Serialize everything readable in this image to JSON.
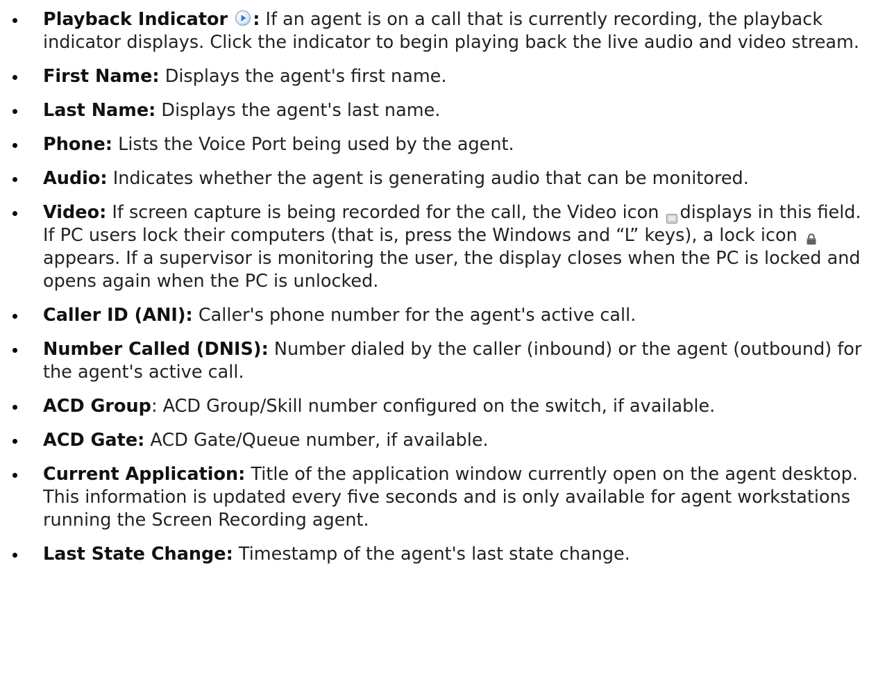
{
  "icons": {
    "playback": "play-circle-icon",
    "video": "video-screen-icon",
    "lock": "lock-icon"
  },
  "items": [
    {
      "term": "Playback Indicator",
      "sep": ":",
      "text": " If an agent is on a call that is currently recording, the playback indicator displays. Click the indicator to begin playing back the live audio and video stream."
    },
    {
      "term": "First Name:",
      "text": " Displays the agent's first name."
    },
    {
      "term": "Last Name:",
      "text": " Displays the agent's last name."
    },
    {
      "term": "Phone:",
      "text": " Lists the Voice Port being used by the agent."
    },
    {
      "term": "Audio:",
      "text": " Indicates whether the agent is generating audio that can be monitored."
    },
    {
      "term": "Video:",
      "text_before_video_icon": " If screen capture is being recorded for the call, the Video icon ",
      "text_before_lock_icon": "displays in this field. If PC users lock their computers (that is, press the Windows  and “L” keys), a lock icon",
      "text_after_lock_icon": "appears. If a supervisor is monitoring the user, the display closes when the PC is locked and opens again when the PC is unlocked."
    },
    {
      "term": "Caller ID (ANI):",
      "text": " Caller's phone number for the agent's active call."
    },
    {
      "term": "Number Called (DNIS):",
      "text": " Number dialed by the caller (inbound) or the agent (outbound) for the agent's active call."
    },
    {
      "term": "ACD Group",
      "text": ": ACD Group/Skill number configured on the switch, if available."
    },
    {
      "term": "ACD Gate:",
      "text": " ACD Gate/Queue number, if available."
    },
    {
      "term": "Current Application:",
      "text": " Title of the application window currently open on the agent desktop. This information is updated every five seconds and is only available for agent workstations running the Screen Recording agent."
    },
    {
      "term": "Last State Change:",
      "text": " Timestamp of the agent's last state change."
    }
  ]
}
